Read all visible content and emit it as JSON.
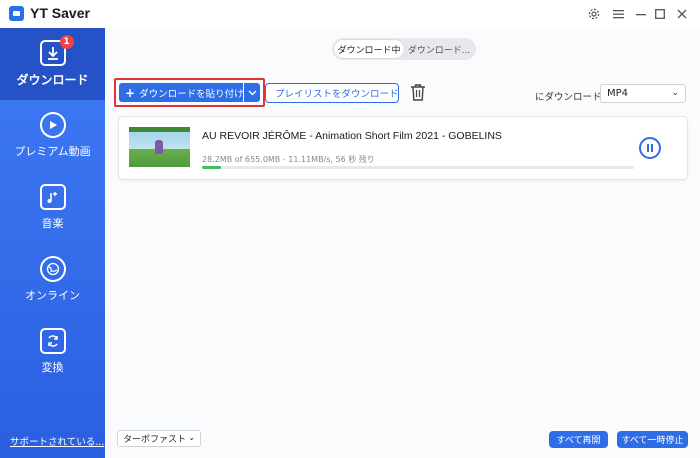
{
  "app": {
    "title": "YT Saver"
  },
  "sidebar": {
    "items": [
      {
        "label": "ダウンロード",
        "icon": "download-icon",
        "badge": "1",
        "active": true
      },
      {
        "label": "プレミアム動画",
        "icon": "play-icon"
      },
      {
        "label": "音楽",
        "icon": "music-note-icon"
      },
      {
        "label": "オンライン",
        "icon": "globe-icon"
      },
      {
        "label": "変換",
        "icon": "convert-icon"
      }
    ],
    "support_link": "サポートされている..."
  },
  "tabs": {
    "downloading": "ダウンロード中",
    "downloaded": "ダウンロード..."
  },
  "toolbar": {
    "paste_label": "ダウンロードを貼り付け",
    "playlist_label": "プレイリストをダウンロード",
    "download_to_label": "にダウンロード",
    "format_value": "MP4"
  },
  "download_item": {
    "title": "AU REVOIR JÉRÔME - Animation Short Film 2021 - GOBELINS",
    "status": "28.2MB of 655.0MB -  11.11MB/s, 56 秒 残り",
    "progress": 0.043
  },
  "footer": {
    "turbo_value": "ターボファスト",
    "resume_all": "すべて再開",
    "pause_all": "すべて一時停止"
  },
  "colors": {
    "accent": "#2f6de6",
    "highlight": "#e23434",
    "progress": "#3fbf5f"
  }
}
